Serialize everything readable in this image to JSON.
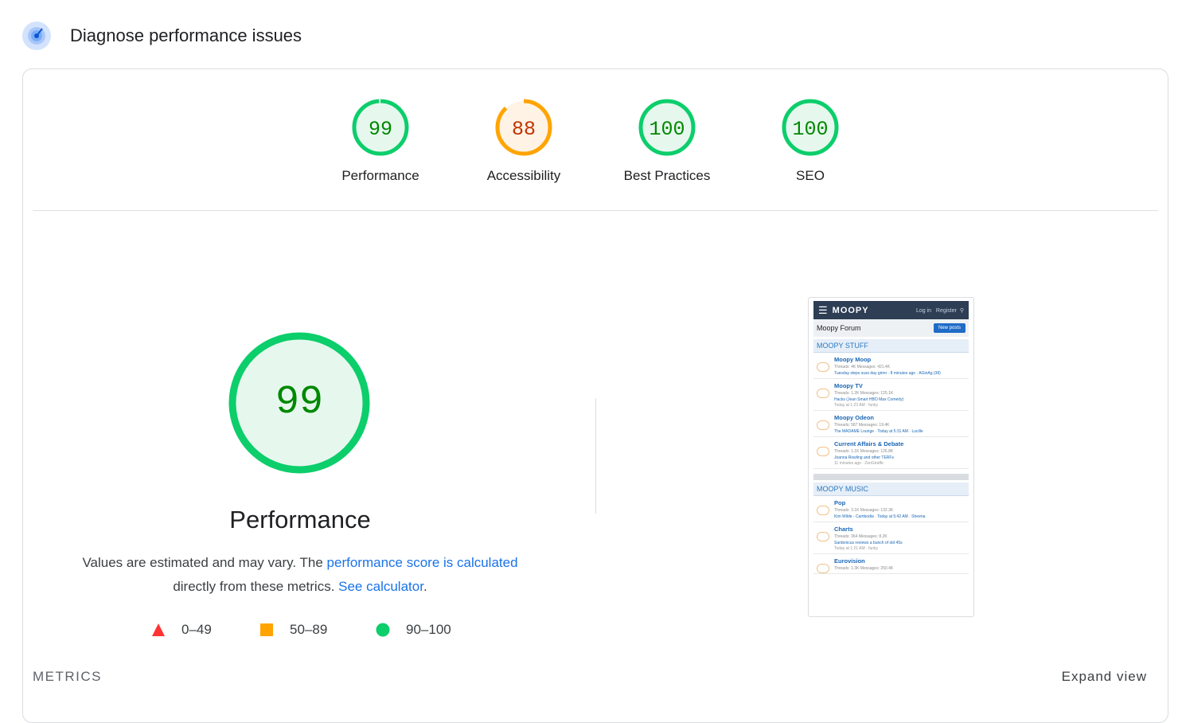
{
  "header": {
    "title": "Diagnose performance issues",
    "icon": "lighthouse-gauge-icon"
  },
  "gauges": [
    {
      "label": "Performance",
      "score": "99",
      "status": "pass",
      "color": "#0cce6b",
      "text_color": "#008800",
      "fill": "#e6f8ee"
    },
    {
      "label": "Accessibility",
      "score": "88",
      "status": "average",
      "color": "#ffa400",
      "text_color": "#c33300",
      "fill": "#fff3e6"
    },
    {
      "label": "Best Practices",
      "score": "100",
      "status": "pass",
      "color": "#0cce6b",
      "text_color": "#008800",
      "fill": "#e6f8ee"
    },
    {
      "label": "SEO",
      "score": "100",
      "status": "pass",
      "color": "#0cce6b",
      "text_color": "#008800",
      "fill": "#e6f8ee"
    }
  ],
  "main": {
    "score": "99",
    "title": "Performance",
    "desc_prefix": "Values are estimated and may vary. The ",
    "desc_link1": "performance score is calculated",
    "desc_middle": " directly from these metrics. ",
    "desc_link2": "See calculator",
    "desc_suffix": "."
  },
  "legend": [
    {
      "range": "0–49",
      "shape": "triangle",
      "color": "#ff3333"
    },
    {
      "range": "50–89",
      "shape": "square",
      "color": "#ffa400"
    },
    {
      "range": "90–100",
      "shape": "circle",
      "color": "#0cce6b"
    }
  ],
  "footer": {
    "metrics": "METRICS",
    "expand": "Expand view"
  },
  "screenshot": {
    "logo": "MOOPY",
    "login": "Log in",
    "register": "Register",
    "forum_title": "Moopy Forum",
    "new_posts": "New posts",
    "cat1": "MOOPY STUFF",
    "cat2": "MOOPY MUSIC",
    "forums1": [
      {
        "title": "Moopy Moop",
        "stats": "Threads: 4K Messages: 421.4K",
        "latest": "Tuesday steps suss day grimr · 8 minutes ago · AGinAg (38)",
        "meta": ""
      },
      {
        "title": "Moopy TV",
        "stats": "Threads: 1.2K Messages: 125.1K",
        "latest": "Hacks (Jean Smart HBO Max Comedy)",
        "meta": "Today at 1:23 AM · funky"
      },
      {
        "title": "Moopy Odeon",
        "stats": "Threads: 587 Messages: 19.4K",
        "latest": "The MADAME Lounge · Today at 5:31 AM · Lucille",
        "meta": ""
      },
      {
        "title": "Current Affairs & Debate",
        "stats": "Threads: 1.1K Messages: 126.8K",
        "latest": "Joanna Rowling and other TERFs",
        "meta": "11 minutes ago · ZenGiraffe"
      }
    ],
    "forums2": [
      {
        "title": "Pop",
        "stats": "Threads: 3.1K Messages: 132.3K",
        "latest": "Kim Wilde - Cambodia · Today at 5:42 AM · Sheena",
        "meta": ""
      },
      {
        "title": "Charts",
        "stats": "Threads: 364 Messages: 8.2K",
        "latest": "Sardonicus reviews a bunch of old 45s",
        "meta": "Today at 1:21 AM · funky"
      },
      {
        "title": "Eurovision",
        "stats": "Threads: 1.3K Messages: 250.4K",
        "latest": "",
        "meta": ""
      }
    ]
  }
}
